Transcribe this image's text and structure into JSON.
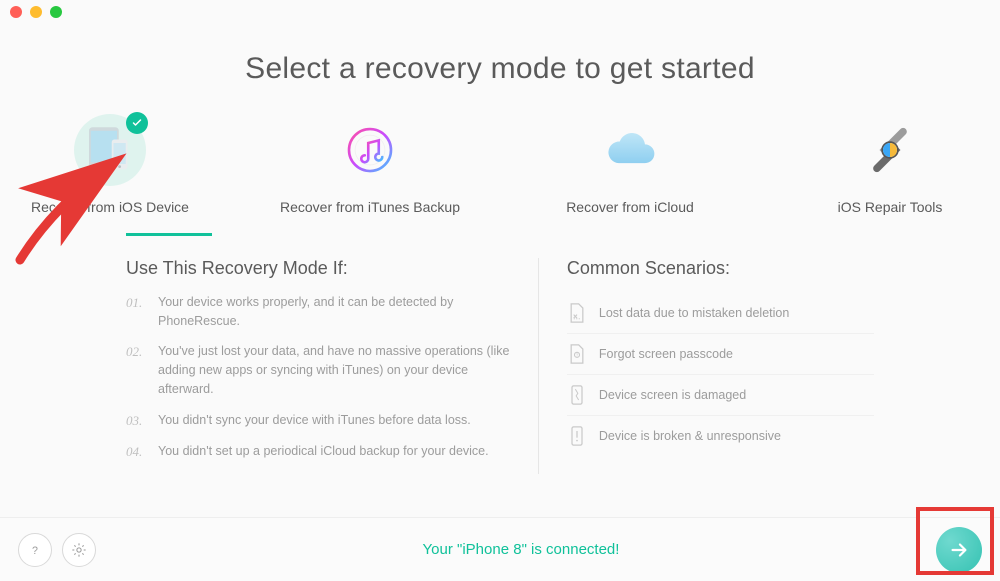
{
  "page_title": "Select a recovery mode to get started",
  "modes": [
    {
      "label": "Recover from iOS Device",
      "selected": true
    },
    {
      "label": "Recover from iTunes Backup",
      "selected": false
    },
    {
      "label": "Recover from iCloud",
      "selected": false
    },
    {
      "label": "iOS Repair Tools",
      "selected": false
    }
  ],
  "details": {
    "heading": "Use This Recovery Mode If:",
    "items": [
      {
        "num": "01.",
        "text": "Your device works properly, and it can be detected by PhoneRescue."
      },
      {
        "num": "02.",
        "text": "You've just lost your data, and have no massive operations (like adding new apps or syncing with iTunes) on your device afterward."
      },
      {
        "num": "03.",
        "text": "You didn't sync your device with iTunes before data loss."
      },
      {
        "num": "04.",
        "text": "You didn't set up a periodical iCloud backup for your device."
      }
    ]
  },
  "scenarios": {
    "heading": "Common Scenarios:",
    "items": [
      "Lost data due to mistaken deletion",
      "Forgot screen passcode",
      "Device screen is damaged",
      "Device is broken & unresponsive"
    ]
  },
  "footer_status": "Your \"iPhone 8\" is connected!",
  "colors": {
    "accent": "#10c19a"
  }
}
